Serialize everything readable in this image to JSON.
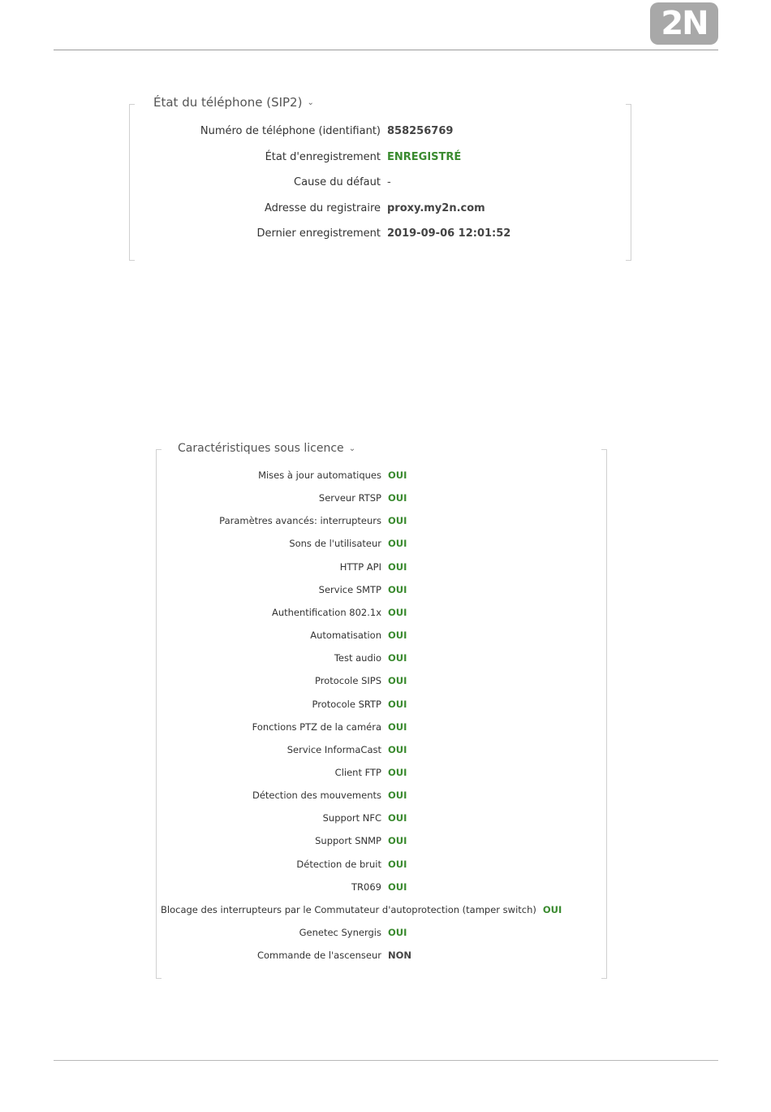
{
  "header": {
    "logo_text": "2N"
  },
  "phone_status": {
    "title": "État du téléphone (SIP2)",
    "rows": [
      {
        "label": "Numéro de téléphone (identifiant)",
        "value": "858256769",
        "status": "normal"
      },
      {
        "label": "État d'enregistrement",
        "value": "ENREGISTRÉ",
        "status": "ok"
      },
      {
        "label": "Cause du défaut",
        "value": "-",
        "status": "plain"
      },
      {
        "label": "Adresse du registraire",
        "value": "proxy.my2n.com",
        "status": "normal"
      },
      {
        "label": "Dernier enregistrement",
        "value": "2019-09-06 12:01:52",
        "status": "normal"
      }
    ]
  },
  "licensed_features": {
    "title": "Caractéristiques sous licence",
    "rows": [
      {
        "label": "Mises à jour automatiques",
        "value": "OUI"
      },
      {
        "label": "Serveur RTSP",
        "value": "OUI"
      },
      {
        "label": "Paramètres avancés: interrupteurs",
        "value": "OUI"
      },
      {
        "label": "Sons de l'utilisateur",
        "value": "OUI"
      },
      {
        "label": "HTTP API",
        "value": "OUI"
      },
      {
        "label": "Service SMTP",
        "value": "OUI"
      },
      {
        "label": "Authentification 802.1x",
        "value": "OUI"
      },
      {
        "label": "Automatisation",
        "value": "OUI"
      },
      {
        "label": "Test audio",
        "value": "OUI"
      },
      {
        "label": "Protocole SIPS",
        "value": "OUI"
      },
      {
        "label": "Protocole SRTP",
        "value": "OUI"
      },
      {
        "label": "Fonctions PTZ de la caméra",
        "value": "OUI"
      },
      {
        "label": "Service InformaCast",
        "value": "OUI"
      },
      {
        "label": "Client FTP",
        "value": "OUI"
      },
      {
        "label": "Détection des mouvements",
        "value": "OUI"
      },
      {
        "label": "Support NFC",
        "value": "OUI"
      },
      {
        "label": "Support SNMP",
        "value": "OUI"
      },
      {
        "label": "Détection de bruit",
        "value": "OUI"
      },
      {
        "label": "TR069",
        "value": "OUI"
      },
      {
        "label": "Blocage des interrupteurs par le Commutateur d'autoprotection (tamper switch)",
        "value": "OUI",
        "wide": true
      },
      {
        "label": "Genetec Synergis",
        "value": "OUI"
      },
      {
        "label": "Commande de l'ascenseur",
        "value": "NON"
      }
    ]
  },
  "colors": {
    "ok": "#3a8a2f",
    "neutral": "#444444",
    "logo_bg": "#a8a8a8"
  }
}
